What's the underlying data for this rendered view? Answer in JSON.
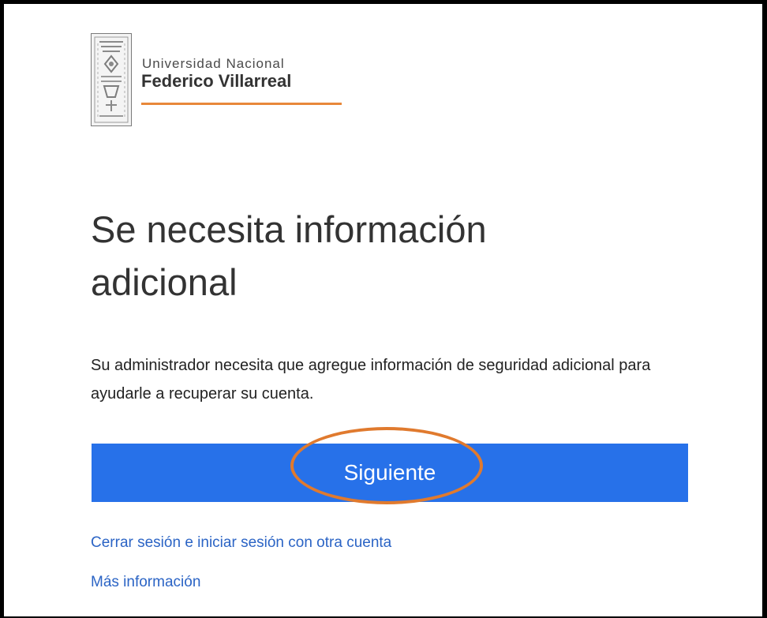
{
  "brand": {
    "line1": "Universidad Nacional",
    "line2": "Federico Villarreal",
    "accent_color": "#e8883a",
    "seal_icon": "university-seal-icon"
  },
  "heading": {
    "title": "Se necesita información adicional"
  },
  "description": "Su administrador necesita que agregue información de seguridad adicional para ayudarle a recuperar su cuenta.",
  "actions": {
    "next_label": "Siguiente",
    "primary_color": "#2771e9",
    "highlight_color": "#e07a2e"
  },
  "links": {
    "switch_account": "Cerrar sesión e iniciar sesión con otra cuenta",
    "more_info": "Más información",
    "link_color": "#2b64c5"
  }
}
